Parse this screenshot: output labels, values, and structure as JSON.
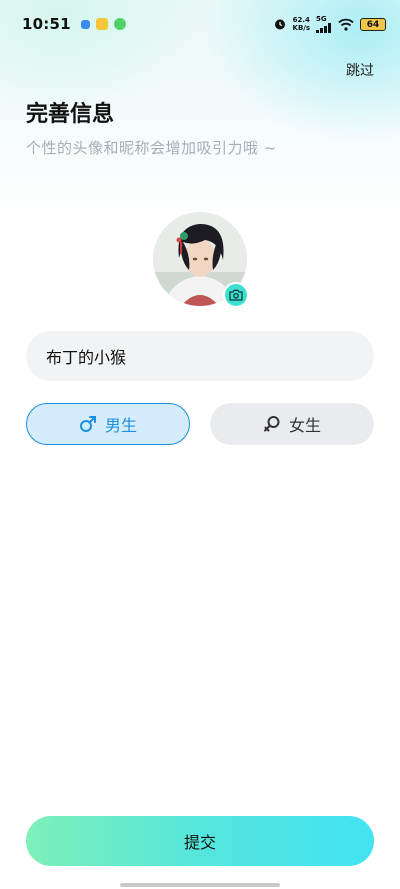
{
  "status_bar": {
    "time": "10:51",
    "net_speed_value": "62.4",
    "net_speed_unit": "KB/s",
    "net_type": "5G",
    "battery": "64"
  },
  "header": {
    "skip": "跳过",
    "title": "完善信息",
    "subtitle": "个性的头像和昵称会增加吸引力哦 ~"
  },
  "profile": {
    "nickname_value": "布丁的小猴"
  },
  "gender": {
    "male_label": "男生",
    "female_label": "女生",
    "selected": "male"
  },
  "actions": {
    "submit_label": "提交"
  },
  "colors": {
    "accent_blue": "#1b8fe0",
    "accent_teal": "#3ee0d2"
  }
}
